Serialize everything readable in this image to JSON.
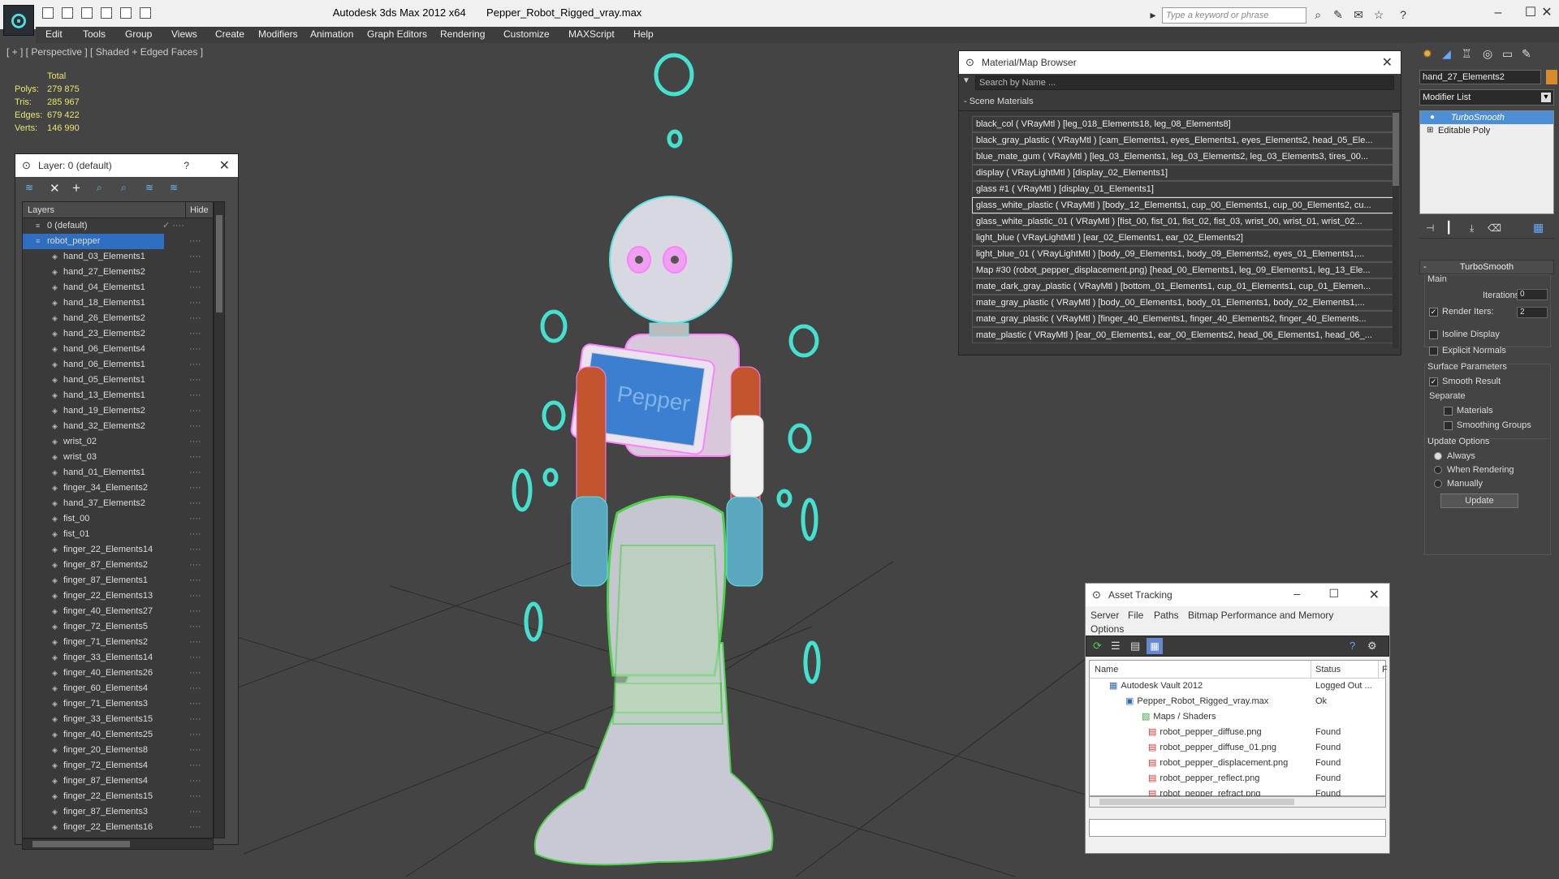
{
  "window": {
    "title_app": "Autodesk 3ds Max  2012 x64",
    "title_file": "Pepper_Robot_Rigged_vray.max",
    "search_placeholder": "Type a keyword or phrase"
  },
  "menu": [
    "Edit",
    "Tools",
    "Group",
    "Views",
    "Create",
    "Modifiers",
    "Animation",
    "Graph Editors",
    "Rendering",
    "Customize",
    "MAXScript",
    "Help"
  ],
  "viewport": {
    "label": "[ + ] [ Perspective ] [ Shaded + Edged Faces ]",
    "stats_header": "Total",
    "stats": [
      {
        "label": "Polys:",
        "value": "279 875"
      },
      {
        "label": "Tris:",
        "value": "285 967"
      },
      {
        "label": "Edges:",
        "value": "679 422"
      },
      {
        "label": "Verts:",
        "value": "146 990"
      }
    ],
    "screen_text": "Pepper"
  },
  "layer_panel": {
    "title": "Layer: 0 (default)",
    "help": "?",
    "col_layers": "Layers",
    "col_hide": "Hide",
    "rows": [
      "0 (default)",
      "robot_pepper",
      "hand_03_Elements1",
      "hand_27_Elements2",
      "hand_04_Elements1",
      "hand_18_Elements1",
      "hand_26_Elements2",
      "hand_23_Elements2",
      "hand_06_Elements4",
      "hand_06_Elements1",
      "hand_05_Elements1",
      "hand_13_Elements1",
      "hand_19_Elements2",
      "hand_32_Elements2",
      "wrist_02",
      "wrist_03",
      "hand_01_Elements1",
      "finger_34_Elements2",
      "hand_37_Elements2",
      "fist_00",
      "fist_01",
      "finger_22_Elements14",
      "finger_87_Elements2",
      "finger_87_Elements1",
      "finger_22_Elements13",
      "finger_40_Elements27",
      "finger_72_Elements5",
      "finger_71_Elements2",
      "finger_33_Elements14",
      "finger_40_Elements26",
      "finger_60_Elements4",
      "finger_71_Elements3",
      "finger_33_Elements15",
      "finger_40_Elements25",
      "finger_20_Elements8",
      "finger_72_Elements4",
      "finger_87_Elements4",
      "finger_22_Elements15",
      "finger_87_Elements3",
      "finger_22_Elements16"
    ]
  },
  "material_browser": {
    "title": "Material/Map Browser",
    "search": "Search by Name ...",
    "section": "- Scene Materials",
    "rows": [
      "black_col  ( VRayMtl )  [leg_018_Elements18, leg_08_Elements8]",
      "black_gray_plastic  ( VRayMtl )  [cam_Elements1, eyes_Elements1, eyes_Elements2, head_05_Ele...",
      "blue_mate_gum  ( VRayMtl )  [leg_03_Elements1, leg_03_Elements2, leg_03_Elements3, tires_00...",
      "display  ( VRayLightMtl )  [display_02_Elements1]",
      "glass #1  ( VRayMtl )  [display_01_Elements1]",
      "glass_white_plastic  ( VRayMtl )  [body_12_Elements1, cup_00_Elements1, cup_00_Elements2, cu...",
      "glass_white_plastic_01  ( VRayMtl )  [fist_00, fist_01, fist_02, fist_03, wrist_00, wrist_01, wrist_02...",
      "light_blue  ( VRayLightMtl )  [ear_02_Elements1, ear_02_Elements2]",
      "light_blue_01  ( VRayLightMtl )  [body_09_Elements1, body_09_Elements2, eyes_01_Elements1,...",
      "Map #30 (robot_pepper_displacement.png)  [head_00_Elements1, leg_09_Elements1, leg_13_Ele...",
      "mate_dark_gray_plastic  ( VRayMtl )  [bottom_01_Elements1, cup_01_Elements1, cup_01_Elemen...",
      "mate_gray_plastic  ( VRayMtl )  [body_00_Elements1, body_01_Elements1, body_02_Elements1,...",
      "mate_gray_plastic  ( VRayMtl )  [finger_40_Elements1, finger_40_Elements2, finger_40_Elements...",
      "mate_plastic  ( VRayMtl )  [ear_00_Elements1, ear_00_Elements2, head_06_Elements1, head_06_..."
    ]
  },
  "asset_tracking": {
    "title": "Asset Tracking",
    "menu": [
      "Server",
      "File",
      "Paths",
      "Bitmap Performance and Memory",
      "Options"
    ],
    "col_name": "Name",
    "col_status": "Status",
    "col_extra": "F",
    "rows": [
      {
        "name": "Autodesk Vault 2012",
        "status": "Logged Out ..."
      },
      {
        "name": "Pepper_Robot_Rigged_vray.max",
        "status": "Ok"
      },
      {
        "name": "Maps / Shaders",
        "status": ""
      },
      {
        "name": "robot_pepper_diffuse.png",
        "status": "Found"
      },
      {
        "name": "robot_pepper_diffuse_01.png",
        "status": "Found"
      },
      {
        "name": "robot_pepper_displacement.png",
        "status": "Found"
      },
      {
        "name": "robot_pepper_reflect.png",
        "status": "Found"
      },
      {
        "name": "robot_pepper_refract.png",
        "status": "Found"
      }
    ]
  },
  "command_panel": {
    "object_name": "hand_27_Elements2",
    "modifier_list": "Modifier List",
    "stack": [
      "TurboSmooth",
      "Editable Poly"
    ],
    "rollout_title": "TurboSmooth",
    "main": "Main",
    "iterations_label": "Iterations:",
    "iterations_value": "0",
    "render_iters_label": "Render Iters:",
    "render_iters_value": "2",
    "isoline": "Isoline Display",
    "explicit": "Explicit Normals",
    "surface_params": "Surface Parameters",
    "smooth_result": "Smooth Result",
    "separate": "Separate",
    "materials": "Materials",
    "smoothing_groups": "Smoothing Groups",
    "update_options": "Update Options",
    "always": "Always",
    "when_rendering": "When Rendering",
    "manually": "Manually",
    "update_btn": "Update"
  }
}
